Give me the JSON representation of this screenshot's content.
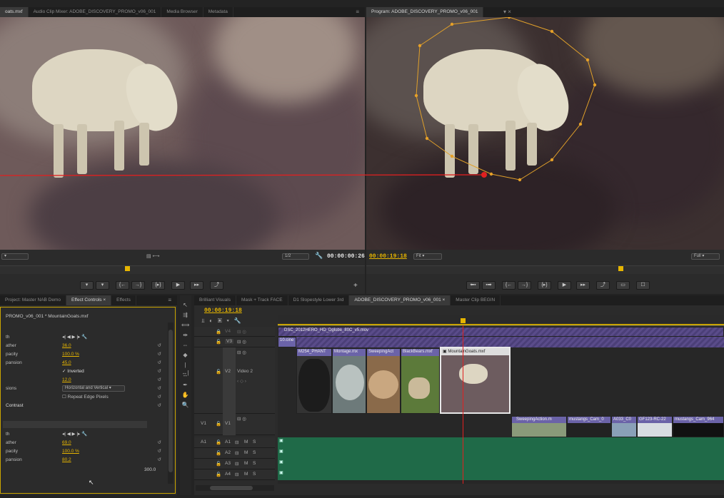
{
  "source": {
    "tabs": [
      "oats.mxf",
      "Audio Clip Mixer: ADOBE_DISCOVERY_PROMO_v06_001",
      "Media Browser",
      "Metadata"
    ],
    "fit_value": "Fit",
    "resolution": "1/2",
    "timecode": "00:00:00:26"
  },
  "program": {
    "tab": "Program: ADOBE_DISCOVERY_PROMO_v06_001",
    "timecode": "00:00:19:18",
    "fit_value": "Fit",
    "resolution": "Full"
  },
  "transport": {
    "source_buttons": [
      "▾",
      "▾",
      "{←",
      "→}",
      "{▸}",
      "▶",
      "▸▸",
      "⤴"
    ],
    "program_buttons": [
      "⬅▪",
      "▪➡",
      "{←",
      "→}",
      "{▸}",
      "▶",
      "▸▸",
      "⤴",
      "▭",
      "☐"
    ]
  },
  "effect_controls": {
    "tabs": [
      "Project: Master NAB Demo",
      "Effect Controls",
      "Effects"
    ],
    "clip_path": "PROMO_v06_001 * MountainGoats.mxf",
    "section1": {
      "header": "th",
      "rows": [
        {
          "label": "ather",
          "value": "36.0"
        },
        {
          "label": "pacity",
          "value": "100.0 %"
        },
        {
          "label": "pansion",
          "value": "45.0"
        },
        {
          "label": "",
          "value": "Inverted",
          "kind": "checkbox",
          "checked": true
        },
        {
          "label": "",
          "value": "12.0"
        },
        {
          "label": "sions",
          "value": "Horizontal and Vertical",
          "kind": "select"
        },
        {
          "label": "",
          "value": "Repeat Edge Pixels",
          "kind": "checkbox",
          "checked": false
        }
      ],
      "contrast_label": "Contrast"
    },
    "section2": {
      "header": "th",
      "rows": [
        {
          "label": "ather",
          "value": "69.0"
        },
        {
          "label": "pacity",
          "value": "100.0 %"
        },
        {
          "label": "pansion",
          "value": "80.2"
        }
      ],
      "bottom_value": "300.0"
    }
  },
  "timeline": {
    "tabs": [
      "Brilliant Visuals",
      "Mask + Track FACE",
      "D1 Slopestyle Lower 3rd",
      "ADOBE_DISCOVERY_PROMO_v06_001",
      "Master Clip BEGIN"
    ],
    "timecode": "00:00:19:18",
    "tracks": {
      "v4": "V4",
      "v3": "V3",
      "v2": "V2",
      "v2_name": "Video 2",
      "v1_src": "V1",
      "v1": "V1",
      "a1_src": "A1",
      "a1": "A1",
      "a2": "A2",
      "a3": "A3",
      "a4": "A4",
      "m": "M",
      "s": "S"
    },
    "clips": {
      "v3_long": "DSC_2012HERO_HD_Dglobe_80C_v5.mov",
      "v3_short": "10.cine",
      "v2": [
        "M254_PHANT",
        "Montage.mx",
        "SweepingAct",
        "BlackBears.mxf",
        "MountainGoats.mxf"
      ],
      "v1": [
        "SweepingAction.m",
        "mustangs_Cam_0",
        "A033_C0",
        "GF123-RC-22",
        "mustangs_Cam_964"
      ]
    }
  },
  "colors": {
    "accent": "#e6b500",
    "playhead": "#e02020",
    "v2_label": "#6b63a8",
    "audio_clip": "#1f6a48"
  }
}
